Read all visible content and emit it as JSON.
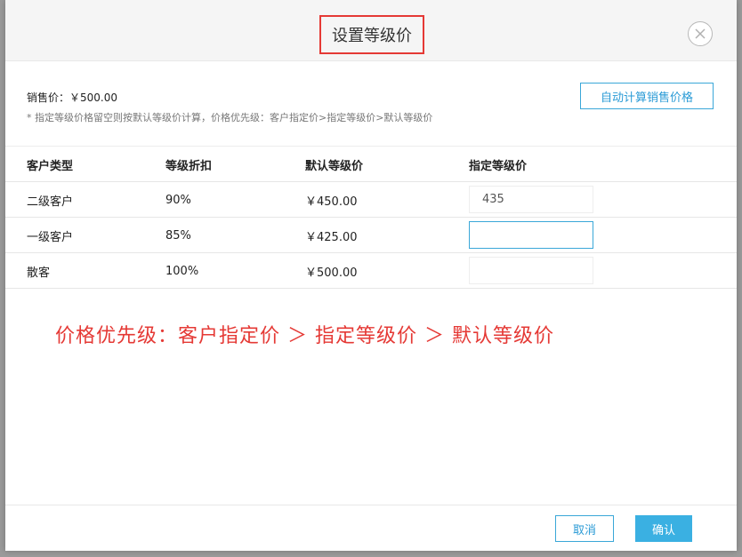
{
  "dialog": {
    "title": "设置等级价",
    "sale_price_label": "销售价：",
    "sale_price_value": "￥500.00",
    "hint": "* 指定等级价格留空则按默认等级价计算，价格优先级：客户指定价>指定等级价>默认等级价",
    "auto_button": "自动计算销售价格"
  },
  "table": {
    "headers": [
      "客户类型",
      "等级折扣",
      "默认等级价",
      "指定等级价"
    ],
    "rows": [
      {
        "type": "二级客户",
        "discount": "90%",
        "default_price": "￥450.00",
        "specified_price": "435"
      },
      {
        "type": "一级客户",
        "discount": "85%",
        "default_price": "￥425.00",
        "specified_price": ""
      },
      {
        "type": "散客",
        "discount": "100%",
        "default_price": "￥500.00",
        "specified_price": ""
      }
    ]
  },
  "annotation": "价格优先级：客户指定价 ＞ 指定等级价 ＞ 默认等级价",
  "footer": {
    "cancel": "取消",
    "confirm": "确认"
  },
  "colors": {
    "accent": "#3aa7d8",
    "annotation_red": "#e53935",
    "confirm_bg": "#3ab0e2"
  }
}
